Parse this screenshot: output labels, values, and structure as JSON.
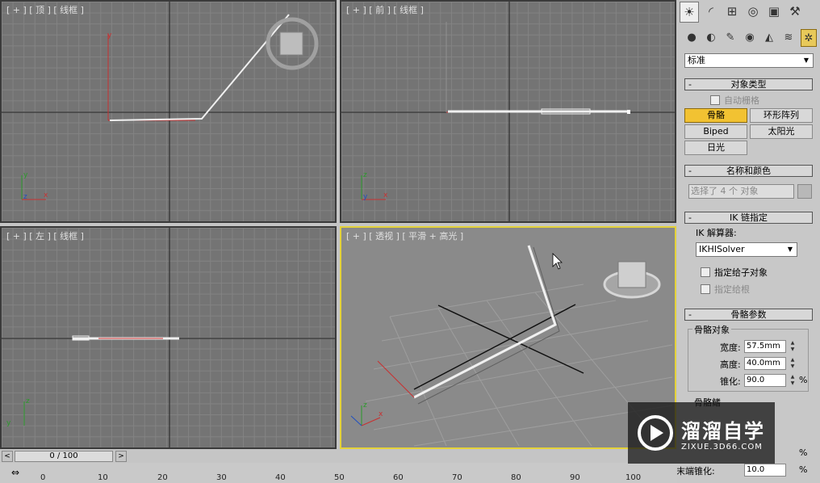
{
  "viewports": {
    "top": {
      "label": "[ + ] [ 顶 ] [ 线框 ]"
    },
    "front": {
      "label": "[ + ] [ 前 ] [ 线框 ]"
    },
    "left": {
      "label": "[ + ] [ 左 ] [ 线框 ]"
    },
    "persp": {
      "label": "[ + ] [ 透视 ] [ 平滑 + 高光 ]"
    }
  },
  "command_panel": {
    "tabs": [
      "create-icon",
      "modify-icon",
      "hierarchy-icon",
      "motion-icon",
      "display-icon",
      "utilities-icon"
    ],
    "category_dropdown": "标准",
    "rollouts": {
      "object_type": {
        "title": "对象类型",
        "auto_grid": "自动栅格",
        "buttons": [
          "骨骼",
          "环形阵列",
          "Biped",
          "太阳光",
          "日光"
        ]
      },
      "name_color": {
        "title": "名称和颜色",
        "value": "选择了 4 个 对象"
      },
      "ik_chain": {
        "title": "IK 链指定",
        "solver_label": "IK 解算器:",
        "solver_value": "IKHISolver",
        "assign_children": "指定给子对象",
        "assign_root": "指定给根"
      },
      "bone_params": {
        "title": "骨骼参数",
        "group": "骨骼对象",
        "width_label": "宽度:",
        "width_value": "57.5mm",
        "height_label": "高度:",
        "height_value": "40.0mm",
        "taper_label": "锥化:",
        "taper_value": "90.0",
        "percent": "%",
        "fins_group": "骨骼鳍",
        "extra_label": "末端锥化:",
        "extra_value": "10.0"
      }
    }
  },
  "timeline": {
    "frame": "0 / 100",
    "ticks": [
      "0",
      "10",
      "20",
      "30",
      "40",
      "50",
      "60",
      "70",
      "80",
      "90",
      "100"
    ]
  },
  "watermark": {
    "brand": "溜溜自学",
    "url": "ZIXUE.3D66.COM"
  },
  "colors": {
    "active_border": "#e4d23a",
    "selected_button": "#f2c232"
  }
}
